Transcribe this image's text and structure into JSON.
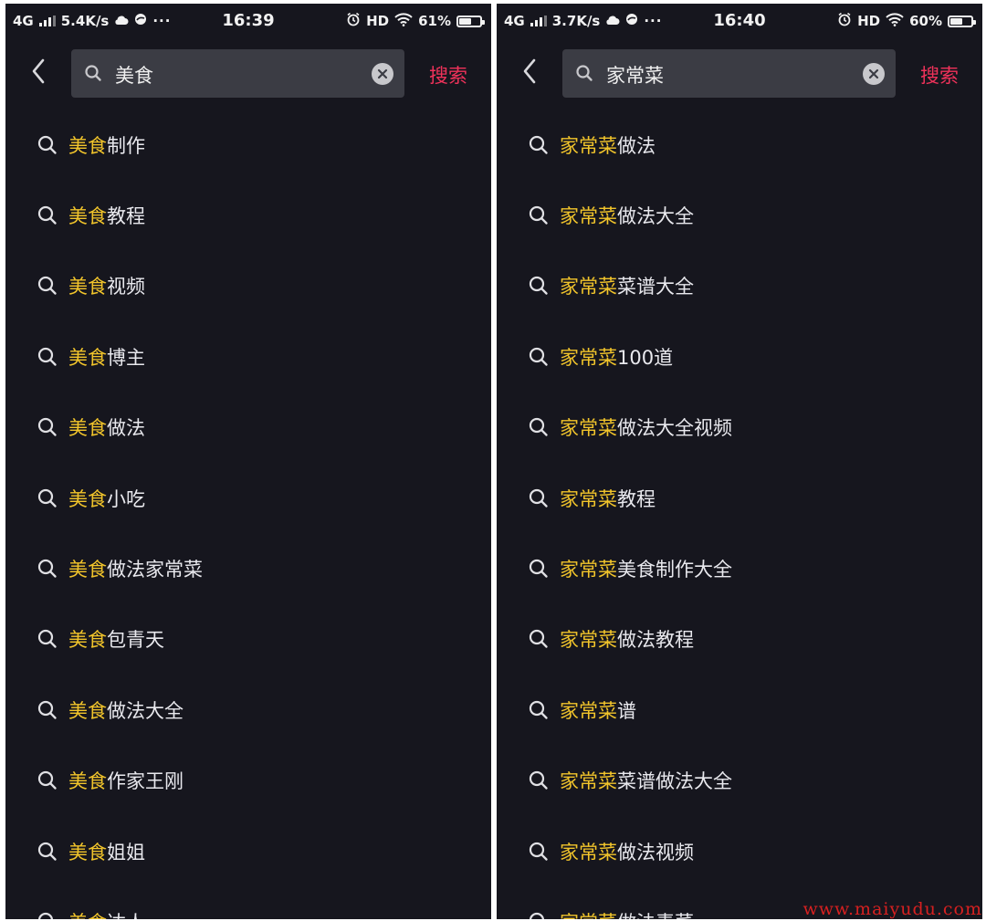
{
  "colors": {
    "background": "#16161e",
    "highlight": "#f2c52b",
    "search_button": "#f0325a",
    "search_box": "#3b3c44",
    "watermark": "#d62020"
  },
  "icons": {
    "back": "chevron-left-icon",
    "search": "search-icon",
    "clear": "clear-icon",
    "suggestion": "search-icon"
  },
  "screens": [
    {
      "status": {
        "network": "4G",
        "speed": "5.4K/s",
        "time": "16:39",
        "hd": "HD",
        "battery_text": "61%",
        "battery_level": 0.61
      },
      "search": {
        "query": "美食",
        "search_button": "搜索"
      },
      "suggestions": [
        {
          "highlight": "美食",
          "rest": "制作"
        },
        {
          "highlight": "美食",
          "rest": "教程"
        },
        {
          "highlight": "美食",
          "rest": "视频"
        },
        {
          "highlight": "美食",
          "rest": "博主"
        },
        {
          "highlight": "美食",
          "rest": "做法"
        },
        {
          "highlight": "美食",
          "rest": "小吃"
        },
        {
          "highlight": "美食",
          "rest": "做法家常菜"
        },
        {
          "highlight": "美食",
          "rest": "包青天"
        },
        {
          "highlight": "美食",
          "rest": "做法大全"
        },
        {
          "highlight": "美食",
          "rest": "作家王刚"
        },
        {
          "highlight": "美食",
          "rest": "姐姐"
        },
        {
          "highlight": "美食",
          "rest": "达人"
        }
      ]
    },
    {
      "status": {
        "network": "4G",
        "speed": "3.7K/s",
        "time": "16:40",
        "hd": "HD",
        "battery_text": "60%",
        "battery_level": 0.6
      },
      "search": {
        "query": "家常菜",
        "search_button": "搜索"
      },
      "suggestions": [
        {
          "highlight": "家常菜",
          "rest": "做法"
        },
        {
          "highlight": "家常菜",
          "rest": "做法大全"
        },
        {
          "highlight": "家常菜",
          "rest": "菜谱大全"
        },
        {
          "highlight": "家常菜",
          "rest": "100道"
        },
        {
          "highlight": "家常菜",
          "rest": "做法大全视频"
        },
        {
          "highlight": "家常菜",
          "rest": "教程"
        },
        {
          "highlight": "家常菜",
          "rest": "美食制作大全"
        },
        {
          "highlight": "家常菜",
          "rest": "做法教程"
        },
        {
          "highlight": "家常菜",
          "rest": "谱"
        },
        {
          "highlight": "家常菜",
          "rest": "菜谱做法大全"
        },
        {
          "highlight": "家常菜",
          "rest": "做法视频"
        },
        {
          "highlight": "家常菜",
          "rest": "做法素菜"
        }
      ]
    }
  ],
  "watermark": "www.maiyudu.com"
}
